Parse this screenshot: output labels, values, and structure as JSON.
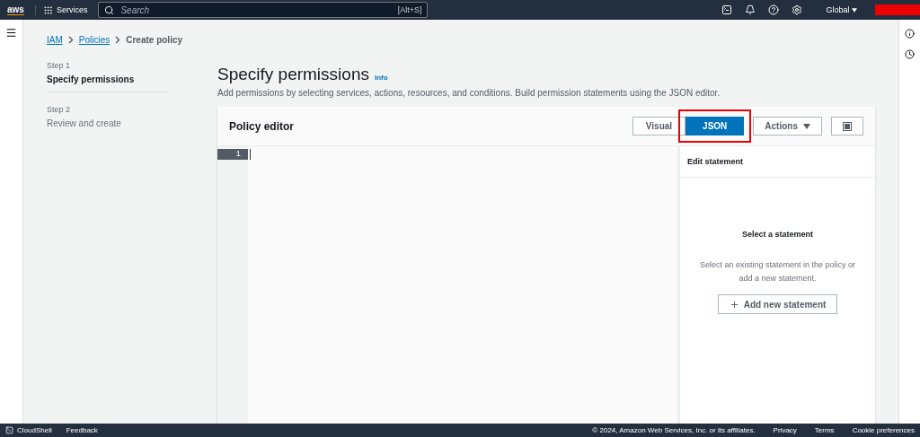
{
  "top_nav": {
    "logo": "aws",
    "services": "Services",
    "search_placeholder": "Search",
    "search_shortcut": "[Alt+S]",
    "region": "Global"
  },
  "breadcrumbs": [
    {
      "label": "IAM",
      "link": true
    },
    {
      "label": "Policies",
      "link": true
    },
    {
      "label": "Create policy",
      "link": false
    }
  ],
  "steps": [
    {
      "step": "Step 1",
      "label": "Specify permissions",
      "selected": true
    },
    {
      "step": "Step 2",
      "label": "Review and create",
      "selected": false
    }
  ],
  "page": {
    "title": "Specify permissions",
    "info": "Info",
    "description": "Add permissions by selecting services, actions, resources, and conditions. Build permission statements using the JSON editor."
  },
  "policy_editor": {
    "title": "Policy editor",
    "modes": [
      {
        "label": "Visual",
        "selected": false,
        "highlighted": false
      },
      {
        "label": "JSON",
        "selected": true,
        "highlighted": true
      }
    ],
    "actions": "Actions",
    "line_numbers": [
      "1"
    ],
    "side_panel": {
      "title": "Edit statement",
      "empty_title": "Select a statement",
      "empty_text": "Select an existing statement in the policy or add a new statement.",
      "add_button": "Add new statement"
    }
  },
  "footer": {
    "cloudshell": "CloudShell",
    "feedback": "Feedback",
    "copyright": "© 2024, Amazon Web Services, Inc. or its affiliates.",
    "links": [
      "Privacy",
      "Terms",
      "Cookie preferences"
    ]
  }
}
